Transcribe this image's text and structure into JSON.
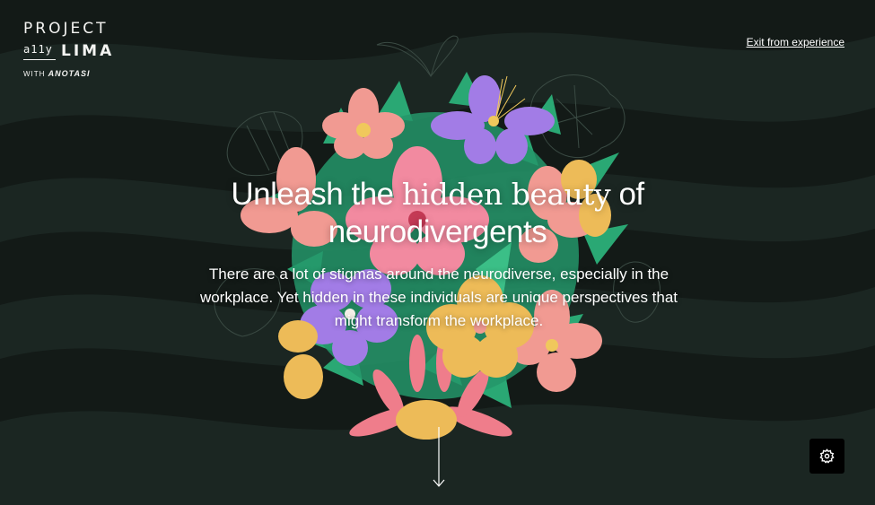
{
  "brand": {
    "line1": "PROJECT",
    "ally": "a11y",
    "lima": "LIMA",
    "with_prefix": "WITH",
    "partner": "ANOTASI"
  },
  "header": {
    "exit_label": "Exit from experience"
  },
  "hero": {
    "title_pre": "Unleash the",
    "title_accent": "hidden beauty",
    "title_post": "of",
    "title_line2": "neurodivergents",
    "body": "There are a lot of stigmas around the neurodiverse, especially in the workplace. Yet hidden in these individuals are unique perspectives that might transform the workplace."
  },
  "icons": {
    "scroll": "arrow-down-icon",
    "settings": "gear-icon"
  },
  "colors": {
    "background": "#131a17",
    "wave": "#1a2621",
    "leaf": "#2aa874",
    "pink": "#f19a92",
    "purple": "#a27ce6",
    "yellow": "#edbb58"
  }
}
